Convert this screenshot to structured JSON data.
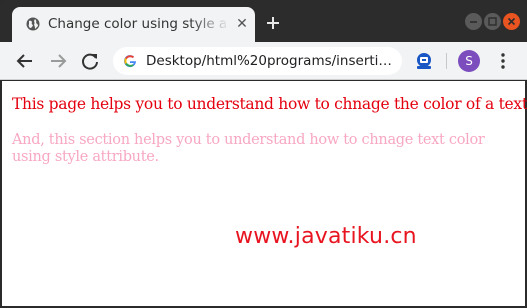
{
  "tab": {
    "title": "Change color using style a"
  },
  "toolbar": {
    "url": "Desktop/html%20programs/inserti…",
    "avatar_letter": "S"
  },
  "page": {
    "paragraph_1": "This page helps you to understand how to chnage the color of a text.",
    "paragraph_2": "And, this section helps you to understand how to chnage text color using style attribute.",
    "watermark": "www.javatiku.cn"
  },
  "colors": {
    "paragraph_1": "#e4000f",
    "paragraph_2": "#f8a7c2",
    "watermark": "#e8141f",
    "accent": "#e95420"
  }
}
